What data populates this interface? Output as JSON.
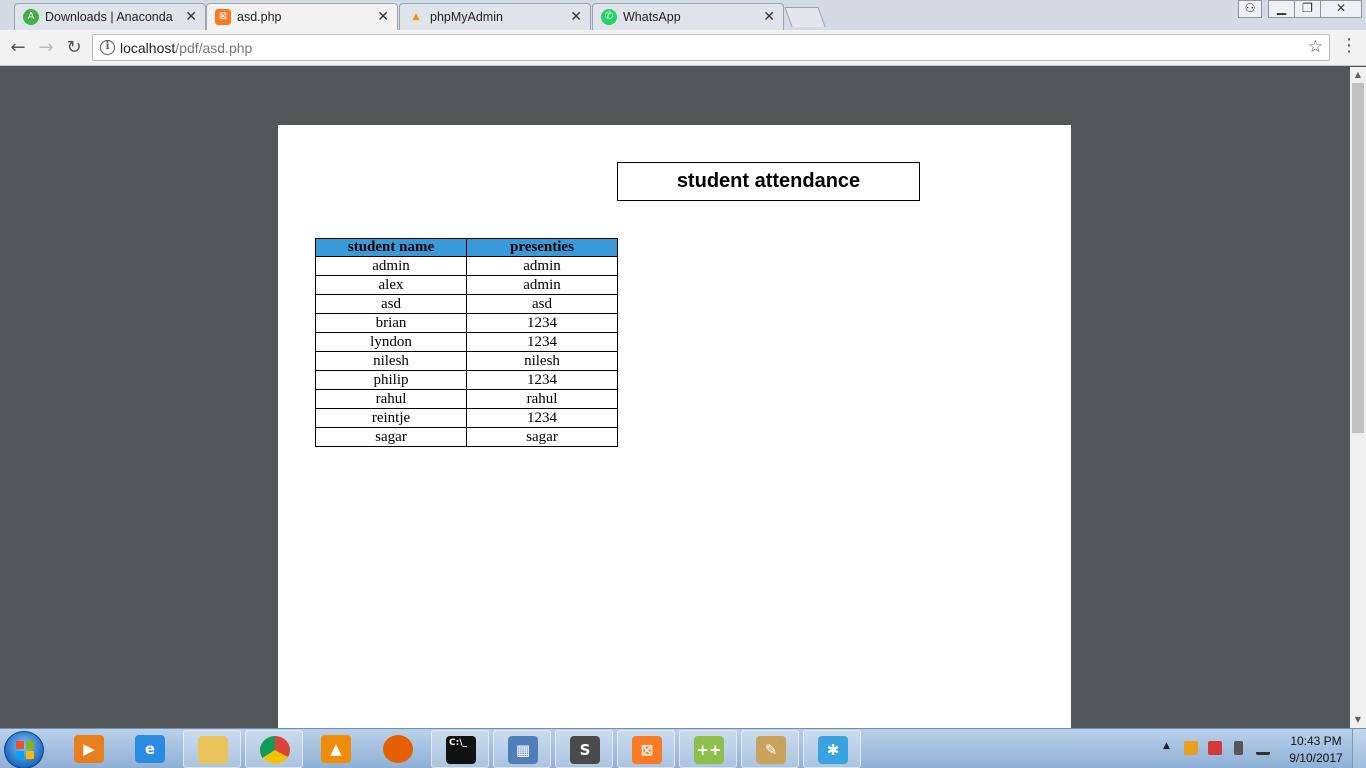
{
  "browser": {
    "tabs": [
      {
        "title": "Downloads | Anaconda",
        "icon": "anaconda-icon",
        "color": "#43b049"
      },
      {
        "title": "asd.php",
        "icon": "xampp-icon",
        "color": "#fb7a24"
      },
      {
        "title": "phpMyAdmin",
        "icon": "phpmyadmin-icon",
        "color": "#f29111"
      },
      {
        "title": "WhatsApp",
        "icon": "whatsapp-icon",
        "color": "#25d366"
      }
    ],
    "active_tab": 1,
    "address": {
      "host": "localhost",
      "path": "/pdf/asd.php"
    }
  },
  "document": {
    "title": "student attendance",
    "table": {
      "headers": [
        "student name",
        "presenties"
      ],
      "header_color": "#3a9ad9",
      "rows": [
        [
          "admin",
          "admin"
        ],
        [
          "alex",
          "admin"
        ],
        [
          "asd",
          "asd"
        ],
        [
          "brian",
          "1234"
        ],
        [
          "lyndon",
          "1234"
        ],
        [
          "nilesh",
          "nilesh"
        ],
        [
          "philip",
          "1234"
        ],
        [
          "rahul",
          "rahul"
        ],
        [
          "reintje",
          "1234"
        ],
        [
          "sagar",
          "sagar"
        ]
      ]
    }
  },
  "taskbar": {
    "apps": [
      {
        "name": "media-player-icon",
        "color": "#e87f1e",
        "glyph": "▶",
        "open": false
      },
      {
        "name": "internet-explorer-icon",
        "color": "#2a8be0",
        "glyph": "e",
        "open": false
      },
      {
        "name": "file-explorer-icon",
        "color": "#e8c35a",
        "glyph": "",
        "open": true
      },
      {
        "name": "chrome-icon",
        "color": "#db4437",
        "glyph": "",
        "open": true
      },
      {
        "name": "vlc-icon",
        "color": "#f28a0a",
        "glyph": "▲",
        "open": false
      },
      {
        "name": "firefox-icon",
        "color": "#e66000",
        "glyph": "",
        "open": false
      },
      {
        "name": "command-prompt-icon",
        "color": "#111111",
        "glyph": "C:\\_",
        "open": true
      },
      {
        "name": "control-panel-icon",
        "color": "#4f7fb8",
        "glyph": "▦",
        "open": true
      },
      {
        "name": "sublime-text-icon",
        "color": "#4a4a4a",
        "glyph": "S",
        "open": true
      },
      {
        "name": "xampp-icon",
        "color": "#fb7a24",
        "glyph": "⊠",
        "open": true
      },
      {
        "name": "notepad-plus-icon",
        "color": "#8fbf4a",
        "glyph": "++",
        "open": true
      },
      {
        "name": "paint-icon",
        "color": "#c9a25c",
        "glyph": "✎",
        "open": true
      },
      {
        "name": "star-app-icon",
        "color": "#3aa3df",
        "glyph": "✱",
        "open": true
      }
    ],
    "clock": {
      "time": "10:43 PM",
      "date": "9/10/2017"
    }
  }
}
